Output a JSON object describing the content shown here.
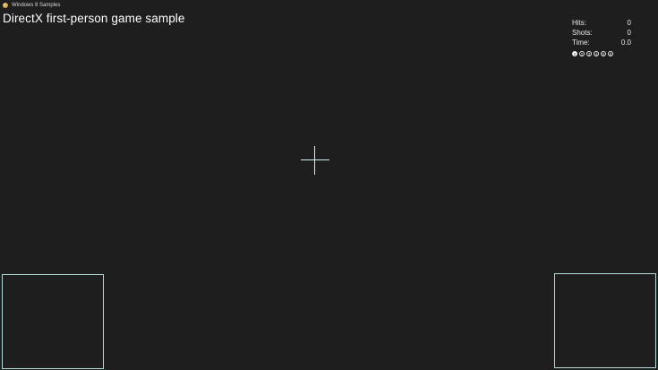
{
  "window": {
    "app_title": "Windows 8 Samples",
    "app_icon": "sample-app-icon"
  },
  "game": {
    "title": "DirectX first-person game sample"
  },
  "hud": {
    "stats": [
      {
        "label": "Hits:",
        "value": "0"
      },
      {
        "label": "Shots:",
        "value": "0"
      },
      {
        "label": "Time:",
        "value": "0.0"
      }
    ],
    "levels": [
      "1",
      "2",
      "3",
      "4",
      "5",
      "6"
    ],
    "active_level": 1
  },
  "colors": {
    "background": "#1e1e1e",
    "crosshair": "#d4ecf0",
    "touch_zone_border": "#b8ddd8"
  }
}
